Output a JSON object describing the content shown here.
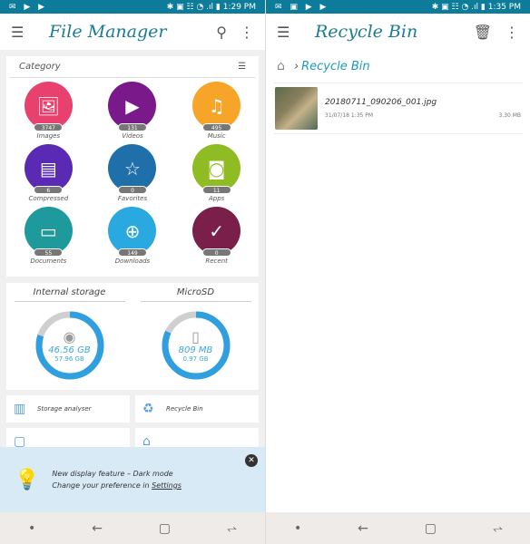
{
  "left": {
    "status": {
      "left_icons": "✉ ▶ ▶",
      "right_icons": "✱ ▣ ☷ ◔ .ıl ▮",
      "time": "1:29 PM"
    },
    "appbar": {
      "title": "File Manager"
    },
    "category": {
      "title": "Category",
      "items": [
        {
          "label": "Images",
          "count": "3747",
          "color": "#e8406f",
          "icon": "🖼"
        },
        {
          "label": "Videos",
          "count": "131",
          "color": "#7a1a8a",
          "icon": "▶"
        },
        {
          "label": "Music",
          "count": "495",
          "color": "#f6a528",
          "icon": "♫"
        },
        {
          "label": "Compressed",
          "count": "6",
          "color": "#5a2ab5",
          "icon": "▤"
        },
        {
          "label": "Favorites",
          "count": "0",
          "color": "#1e6faa",
          "icon": "☆"
        },
        {
          "label": "Apps",
          "count": "11",
          "color": "#8ebc22",
          "icon": "◙"
        },
        {
          "label": "Documents",
          "count": "55",
          "color": "#1e9a9c",
          "icon": "▭"
        },
        {
          "label": "Downloads",
          "count": "149",
          "color": "#2aa9e0",
          "icon": "⊕"
        },
        {
          "label": "Recent",
          "count": "0",
          "color": "#7a1e4a",
          "icon": "✓"
        }
      ]
    },
    "storage": [
      {
        "title": "Internal storage",
        "used": "46.56 GB",
        "total": "57.96 GB",
        "used_fraction": 0.8,
        "icon": "◉"
      },
      {
        "title": "MicroSD",
        "used": "809 MB",
        "total": "0.97 GB",
        "used_fraction": 0.82,
        "icon": "▯"
      }
    ],
    "tools": [
      {
        "label": "Storage analyser",
        "icon": "▥"
      },
      {
        "label": "Recycle Bin",
        "icon": "♻"
      },
      {
        "label": "",
        "icon": "▢"
      },
      {
        "label": "",
        "icon": "⌂"
      }
    ],
    "banner": {
      "line1": "New display feature – Dark mode",
      "line2": "Change your preference in ",
      "link": "Settings"
    }
  },
  "right": {
    "status": {
      "left_icons": "✉ ▣ ▶ ▶",
      "right_icons": "✱ ▣ ☷ ◔ .ıl ▮",
      "time": "1:35 PM"
    },
    "appbar": {
      "title": "Recycle Bin"
    },
    "breadcrumb": {
      "label": "Recycle Bin"
    },
    "files": [
      {
        "name": "20180711_090206_001.jpg",
        "date": "31/07/18 1:35 PM",
        "size": "3.30 MB"
      }
    ]
  },
  "nav": {
    "recent": "⥋",
    "home": "▢",
    "back": "←",
    "dot": "•"
  }
}
